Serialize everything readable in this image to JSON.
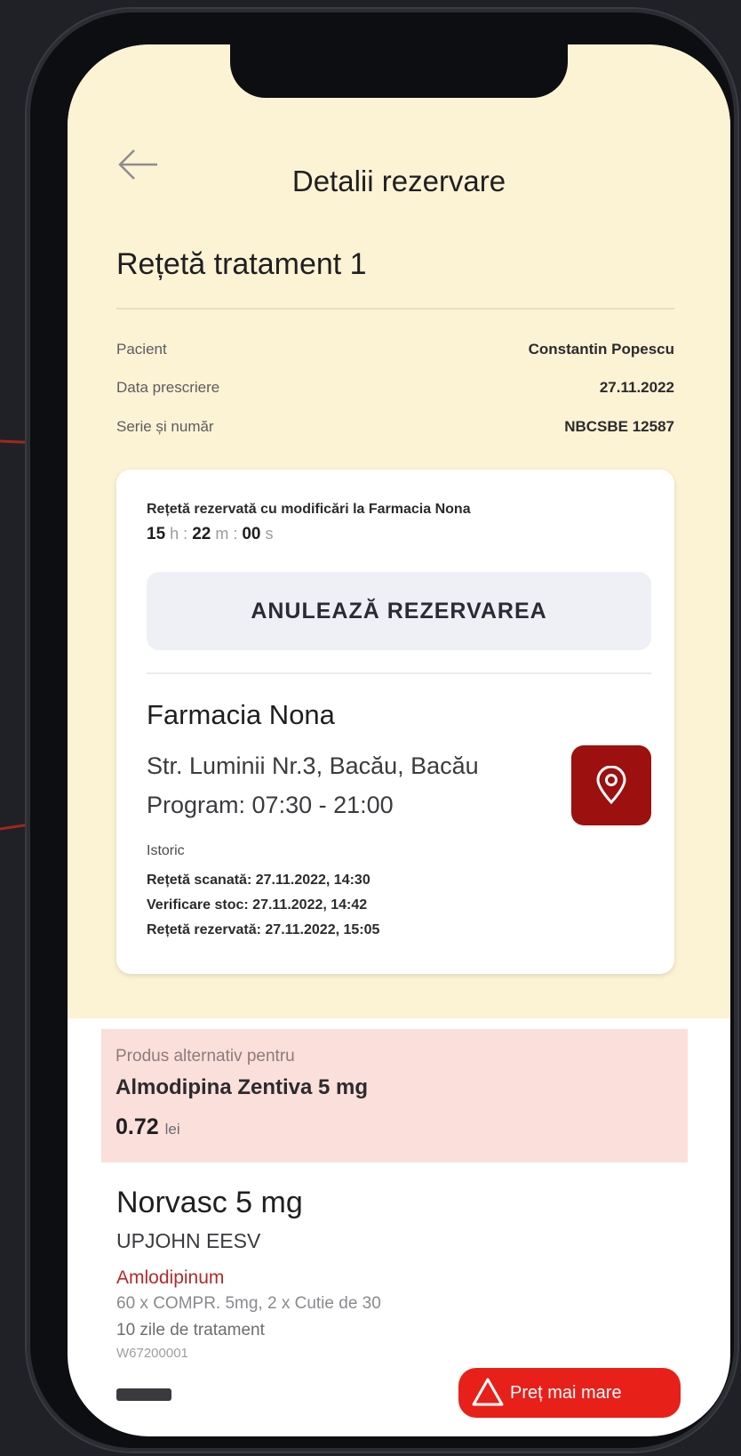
{
  "header": {
    "title": "Detalii rezervare"
  },
  "prescription": {
    "title": "Rețetă tratament 1",
    "rows": [
      {
        "label": "Pacient",
        "value": "Constantin Popescu"
      },
      {
        "label": "Data prescriere",
        "value": "27.11.2022"
      },
      {
        "label": "Serie și număr",
        "value": "NBCSBE 12587"
      }
    ]
  },
  "reservation": {
    "status_text": "Rețetă rezervată cu modificări la Farmacia Nona",
    "timer": {
      "h": "15",
      "h_unit": "h",
      "m": "22",
      "m_unit": "m",
      "s": "00",
      "s_unit": "s"
    },
    "cancel_label": "ANULEAZĂ REZERVAREA"
  },
  "pharmacy": {
    "name": "Farmacia Nona",
    "address": "Str. Luminii Nr.3, Bacău, Bacău",
    "hours": "Program: 07:30 - 21:00",
    "map_icon": "map-pin-icon"
  },
  "history": {
    "label": "Istoric",
    "entries": [
      "Rețetă scanată: 27.11.2022, 14:30",
      "Verificare stoc: 27.11.2022, 14:42",
      "Rețetă rezervată: 27.11.2022, 15:05"
    ]
  },
  "alternative": {
    "label": "Produs alternativ pentru",
    "name": "Almodipina Zentiva 5 mg",
    "price": "0.72",
    "currency": "lei"
  },
  "product": {
    "name": "Norvasc 5 mg",
    "maker": "UPJOHN EESV",
    "substance": "Amlodipinum",
    "pack": "60 x COMPR. 5mg, 2 x Cutie de 30",
    "duration": "10 zile de tratament",
    "code": "W67200001",
    "more_label": "Preț mai mare"
  },
  "colors": {
    "background": "#fcf3d4",
    "accent": "#9c1010",
    "alert_bg": "#fbdfdb",
    "danger": "#e8201a"
  }
}
